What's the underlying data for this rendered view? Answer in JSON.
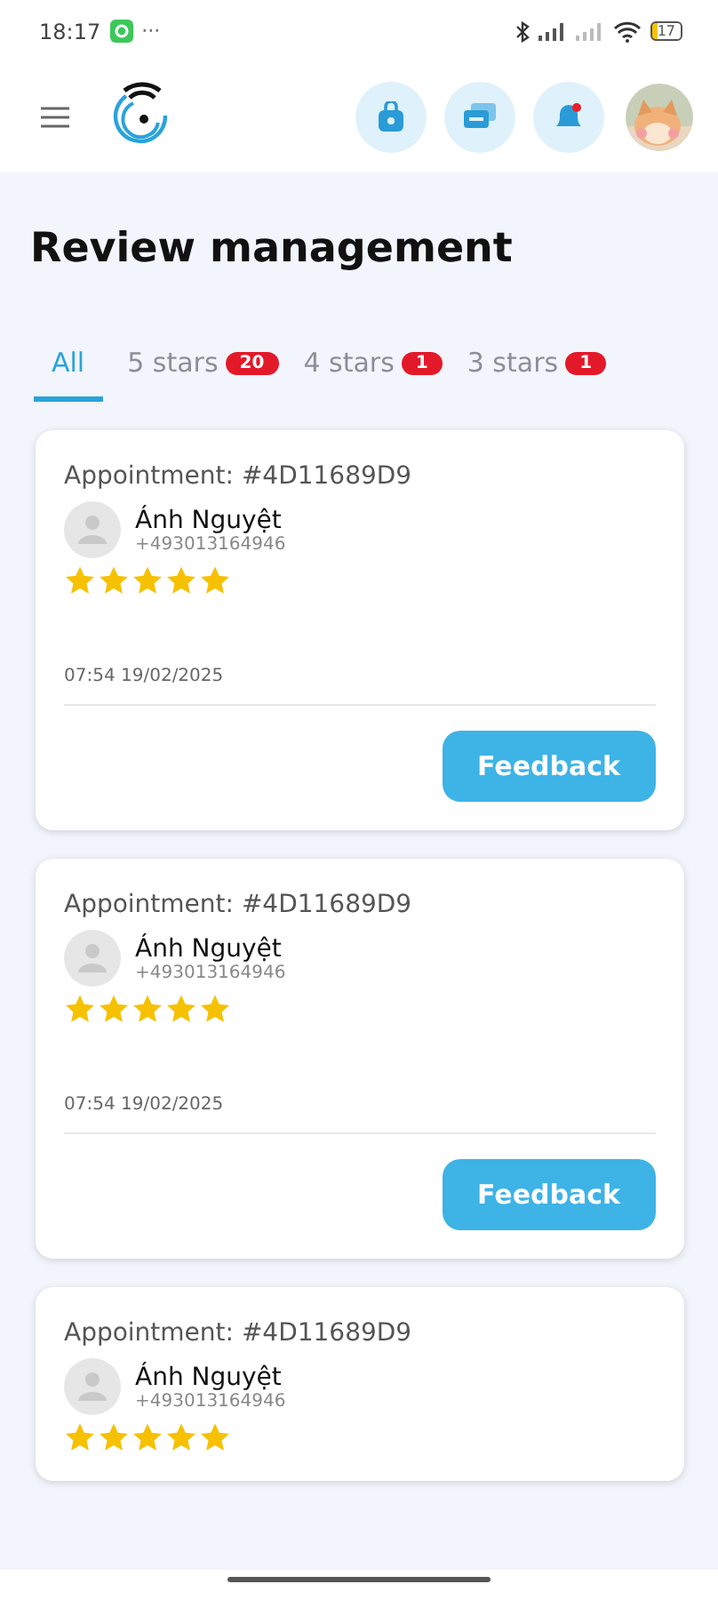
{
  "status_bar": {
    "time": "18:17",
    "more": "···",
    "battery": "17"
  },
  "title": "Review management",
  "tabs": [
    {
      "label": "All",
      "selected": true
    },
    {
      "label": "5 stars",
      "count": "20",
      "selected": false
    },
    {
      "label": "4 stars",
      "count": "1",
      "selected": false
    },
    {
      "label": "3 stars",
      "count": "1",
      "selected": false
    }
  ],
  "reviews": [
    {
      "appointment": "Appointment: #4D11689D9",
      "name": "Ánh Nguyệt",
      "phone": "+493013164946",
      "stars": 5,
      "time": "07:54 19/02/2025",
      "button": "Feedback"
    },
    {
      "appointment": "Appointment: #4D11689D9",
      "name": "Ánh Nguyệt",
      "phone": "+493013164946",
      "stars": 5,
      "time": "07:54 19/02/2025",
      "button": "Feedback"
    },
    {
      "appointment": "Appointment: #4D11689D9",
      "name": "Ánh Nguyệt",
      "phone": "+493013164946",
      "stars": 5
    }
  ]
}
